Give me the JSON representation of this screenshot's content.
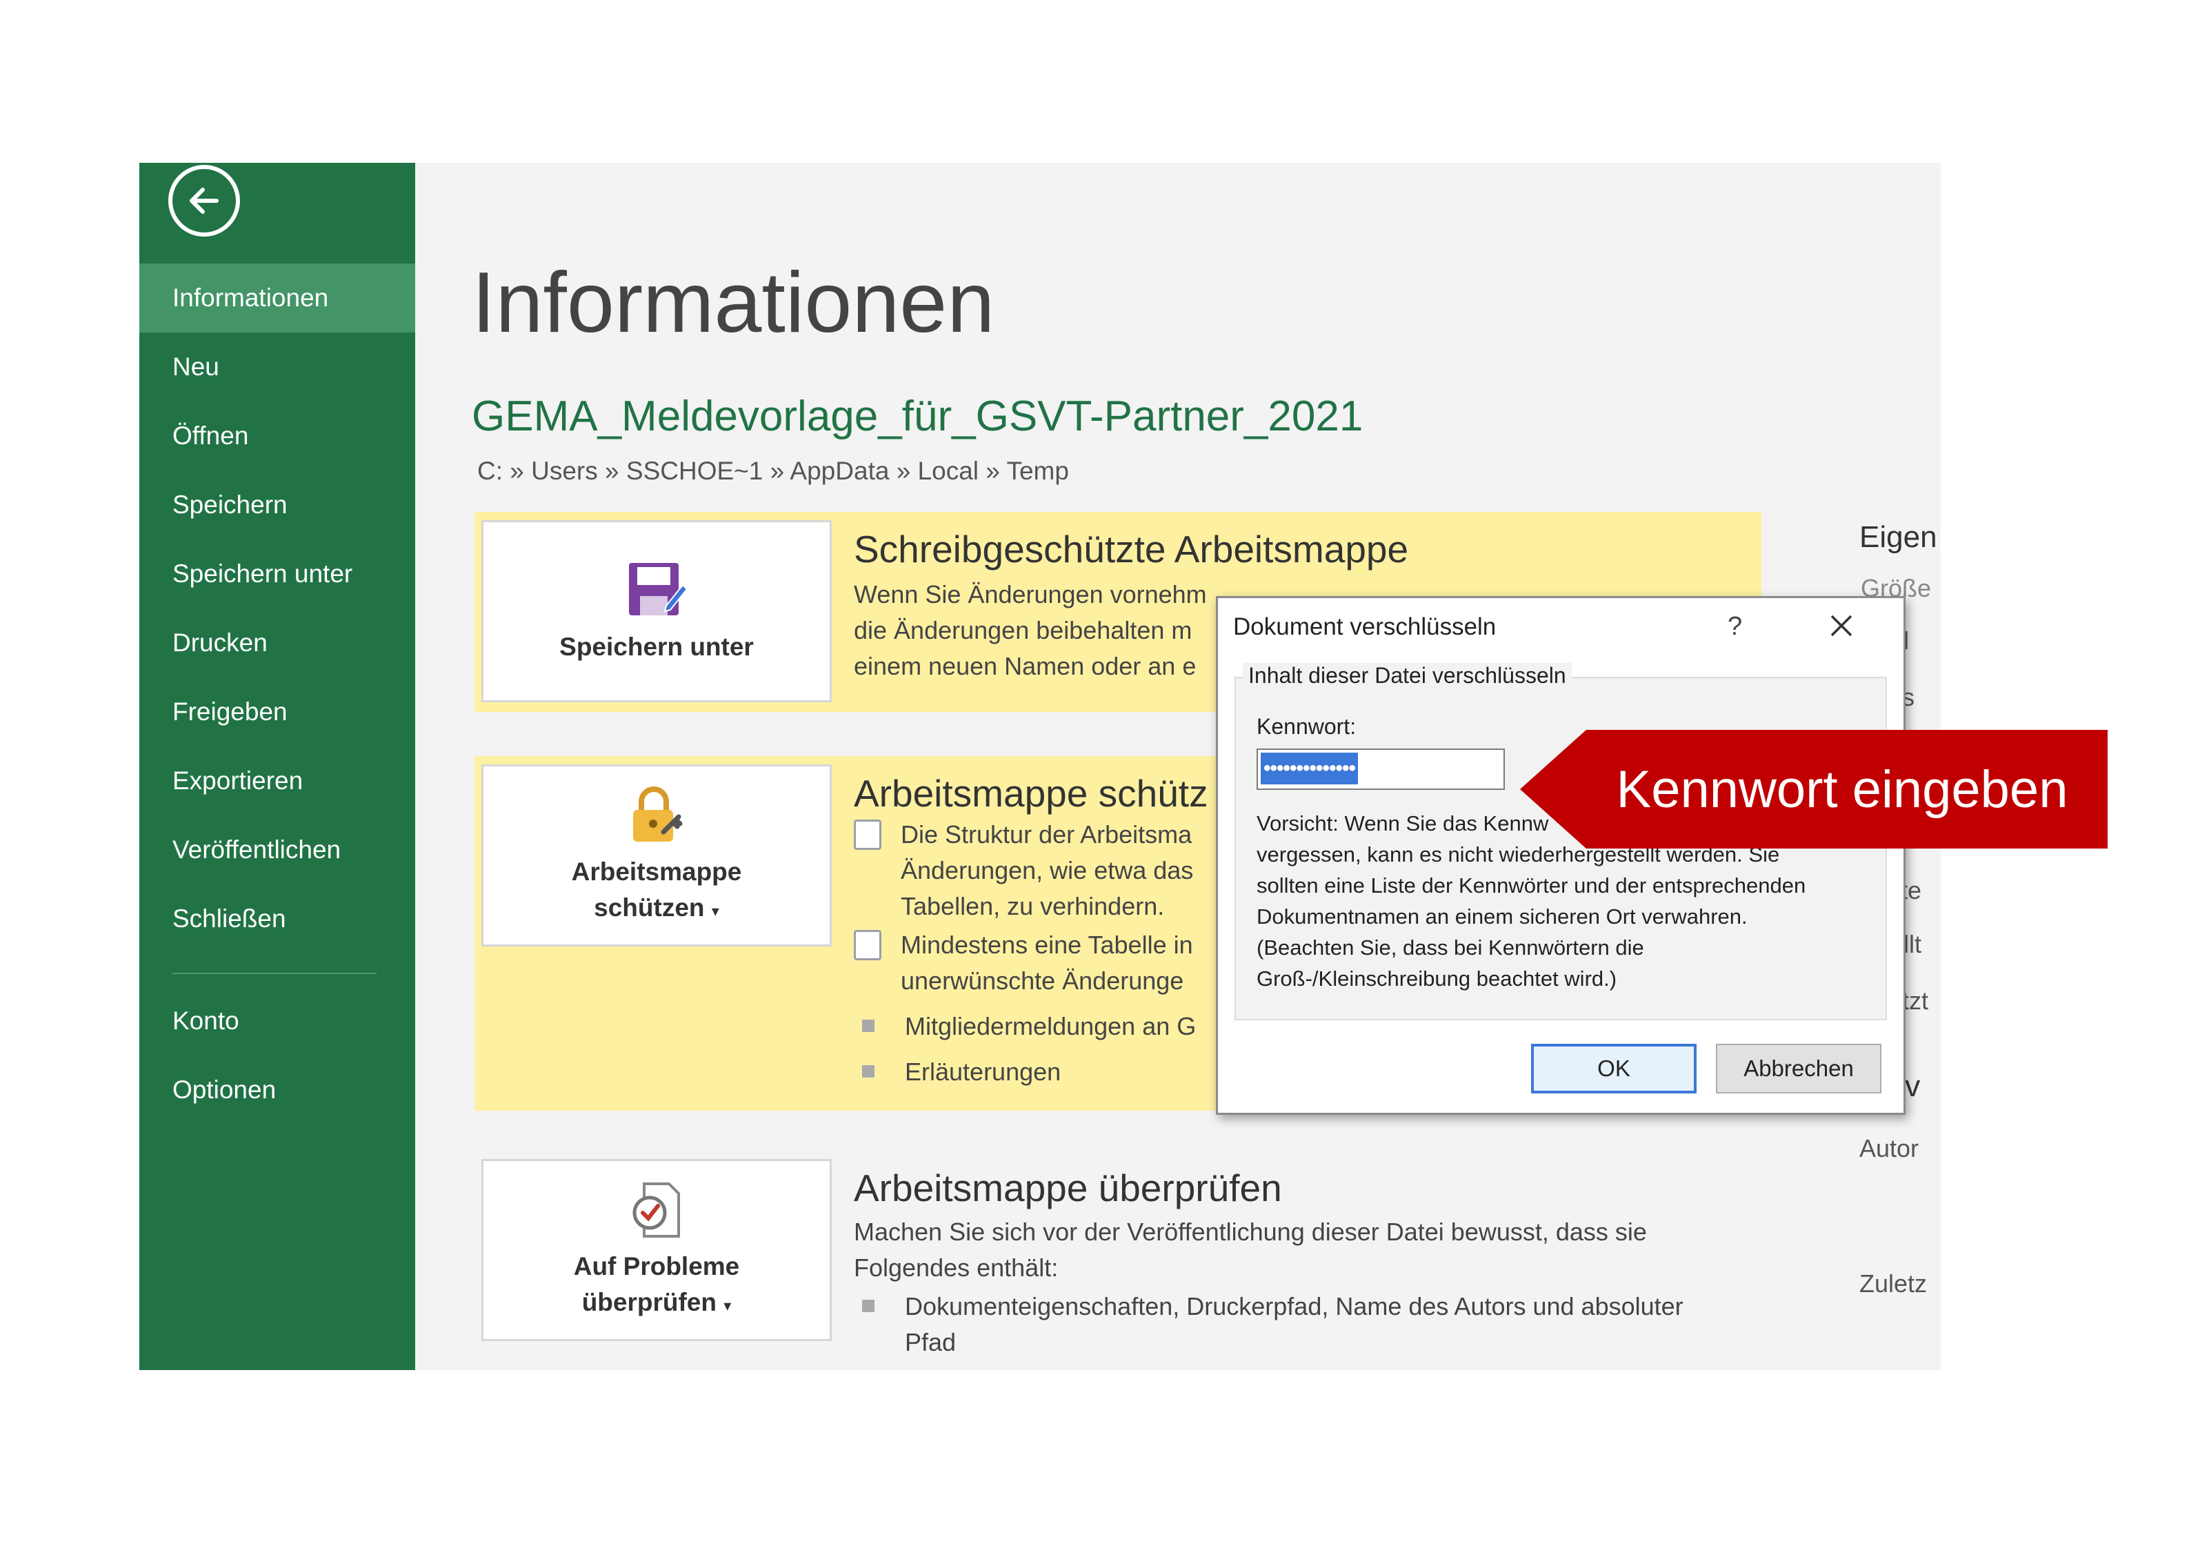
{
  "sidebar": {
    "items": [
      {
        "label": "Informationen",
        "active": true
      },
      {
        "label": "Neu"
      },
      {
        "label": "Öffnen"
      },
      {
        "label": "Speichern"
      },
      {
        "label": "Speichern unter"
      },
      {
        "label": "Drucken"
      },
      {
        "label": "Freigeben"
      },
      {
        "label": "Exportieren"
      },
      {
        "label": "Veröffentlichen"
      },
      {
        "label": "Schließen"
      }
    ],
    "bottom_items": [
      {
        "label": "Konto"
      },
      {
        "label": "Optionen"
      }
    ]
  },
  "main": {
    "title": "Informationen",
    "file_name": "GEMA_Meldevorlage_für_GSVT-Partner_2021",
    "path": "C: » Users » SSCHOE~1 » AppData » Local » Temp",
    "readonly": {
      "button_label": "Speichern unter",
      "heading": "Schreibgeschützte Arbeitsmappe",
      "text_lines": [
        "Wenn Sie Änderungen vornehm",
        "die Änderungen beibehalten m",
        "einem neuen Namen oder an e"
      ]
    },
    "protect": {
      "button_label_1": "Arbeitsmappe",
      "button_label_2": "schützen",
      "heading": "Arbeitsmappe schütz",
      "bullets": [
        {
          "line1": "Die Struktur der Arbeitsma",
          "line2": "Änderungen, wie etwa das",
          "line3": "Tabellen, zu verhindern."
        },
        {
          "line1": "Mindestens eine Tabelle in",
          "line2": "unerwünschte Änderunge"
        }
      ],
      "plain_bullets": [
        "Mitgliedermeldungen an G",
        "Erläuterungen"
      ]
    },
    "inspect": {
      "button_label_1": "Auf Probleme",
      "button_label_2": "überprüfen",
      "heading": "Arbeitsmappe überprüfen",
      "text_1": "Machen Sie sich vor der Veröffentlichung dieser Datei bewusst, dass sie",
      "text_2": "Folgendes enthält:",
      "bullet_1": "Dokumenteigenschaften, Druckerpfad, Name des Autors und absoluter",
      "bullet_2": "Pfad"
    }
  },
  "properties": {
    "heading": "Eigen",
    "cut_labels": [
      "Größe",
      "el",
      "gs",
      "tzte",
      "tellt",
      "letzt",
      "lev",
      "Autor",
      "Zuletz"
    ]
  },
  "dialog": {
    "title": "Dokument verschlüsseln",
    "help": "?",
    "group_label": "Inhalt dieser Datei verschlüsseln",
    "password_label": "Kennwort:",
    "password_value": "••••••••••••••",
    "warning_lines": [
      "Vorsicht: Wenn Sie das Kennw",
      "vergessen, kann es nicht wiederhergestellt werden. Sie",
      "sollten eine Liste der Kennwörter und der entsprechenden",
      "Dokumentnamen an einem sicheren Ort verwahren.",
      "(Beachten Sie, dass bei Kennwörtern die",
      "Groß-/Kleinschreibung beachtet wird.)"
    ],
    "ok_label": "OK",
    "cancel_label": "Abbrechen"
  },
  "callout": {
    "text": "Kennwort eingeben",
    "color": "#c00000"
  },
  "colors": {
    "sidebar": "#217346",
    "sidebar_active": "#439467",
    "panel": "#fdf0a1",
    "accent": "#217346"
  }
}
